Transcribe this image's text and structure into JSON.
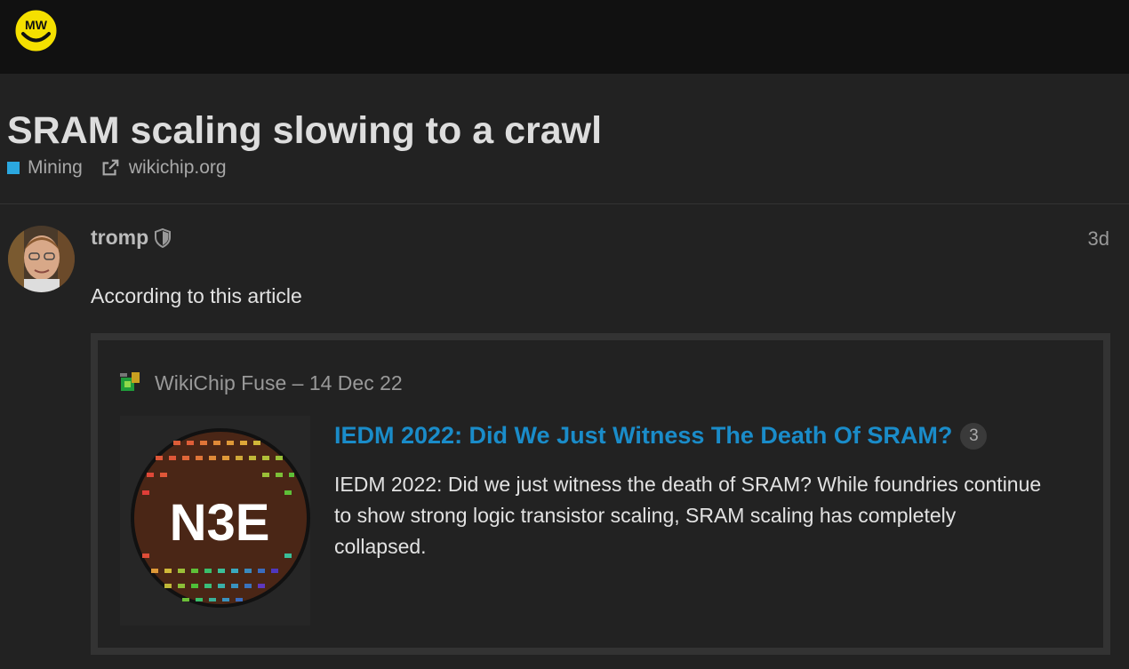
{
  "header": {
    "logo": "mw-logo"
  },
  "topic": {
    "title": "SRAM scaling slowing to a crawl",
    "category": "Mining",
    "category_color": "#2ba8e0",
    "link_domain": "wikichip.org"
  },
  "post": {
    "username": "tromp",
    "date": "3d",
    "text": "According to this article",
    "onebox": {
      "source": "WikiChip Fuse – 14 Dec 22",
      "title": "IEDM 2022: Did We Just Witness The Death Of SRAM?",
      "count": "3",
      "description": "IEDM 2022: Did we just witness the death of SRAM? While foundries continue to show strong logic transistor scaling, SRAM scaling has completely collapsed.",
      "thumbnail_text": "N3E"
    }
  },
  "colors": {
    "link": "#1a8cc9",
    "background": "#222222",
    "header": "#111111"
  }
}
